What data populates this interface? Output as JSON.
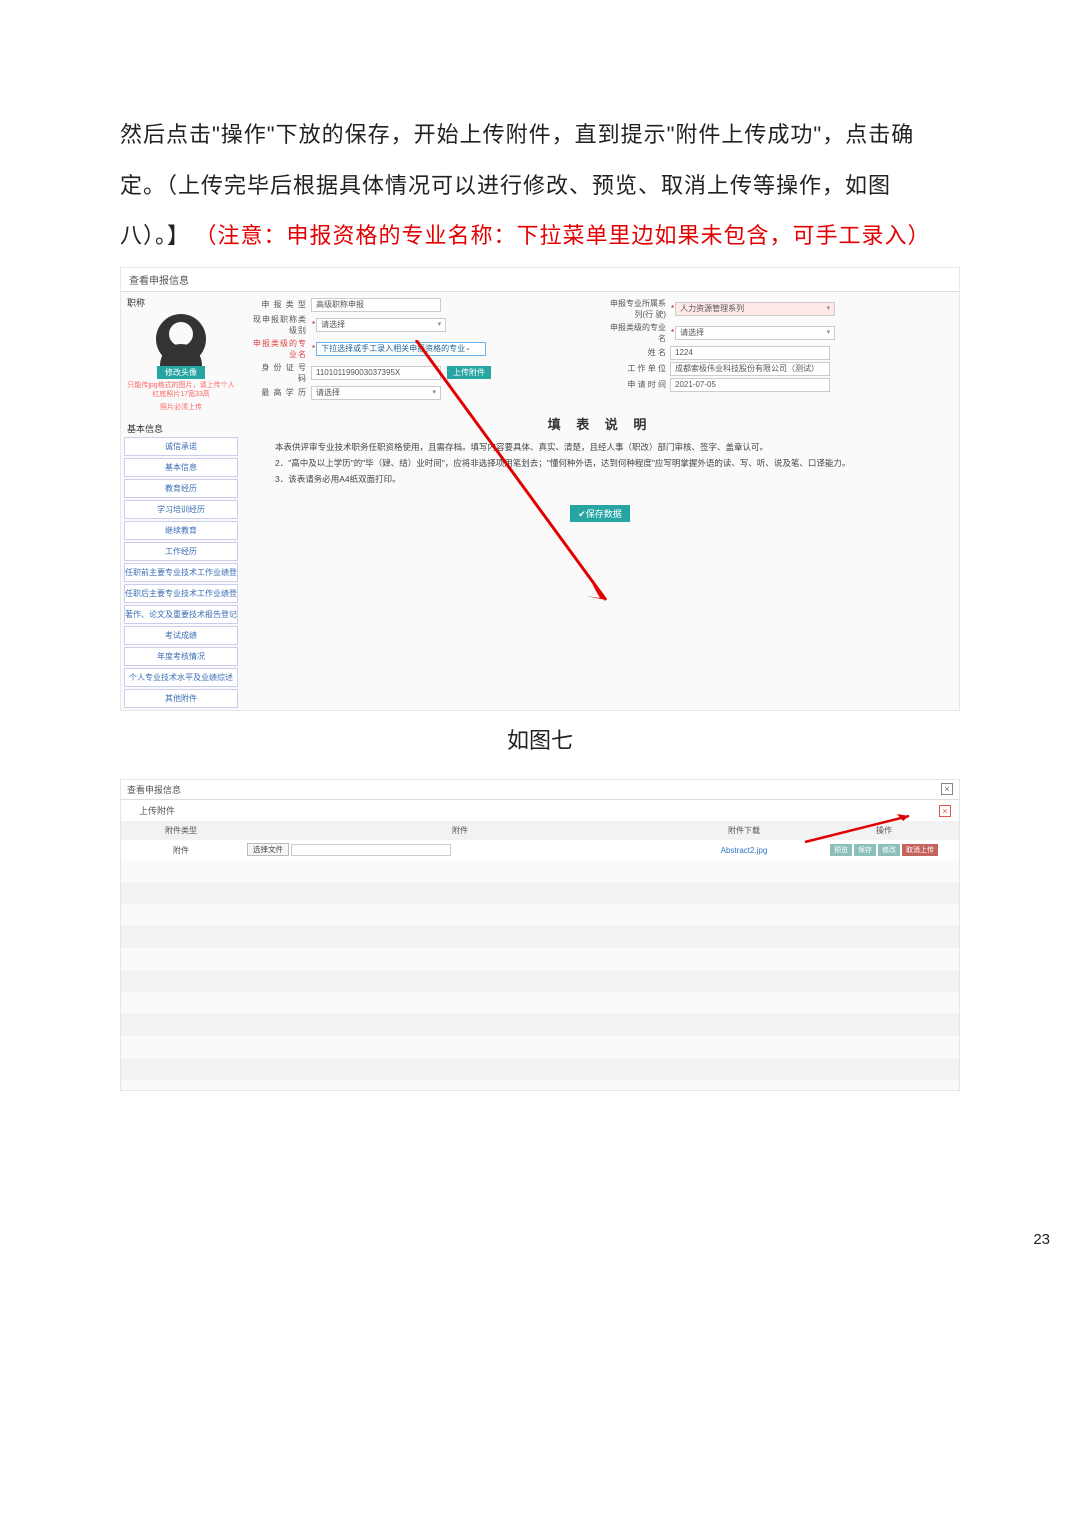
{
  "paragraph": {
    "black": "然后点击\"操作\"下放的保存，开始上传附件，直到提示\"附件上传成功\"，点击确定。（上传完毕后根据具体情况可以进行修改、预览、取消上传等操作，如图八）。】",
    "red": "（注意：申报资格的专业名称：下拉菜单里边如果未包含，可手工录入）"
  },
  "fig1_caption": "如图七",
  "page_number": "23",
  "s1": {
    "title": "查看申报信息",
    "sidebar": {
      "cat1": "职称",
      "cat2": "基本信息",
      "avatar_btn": "修改头像",
      "avatar_hint1": "只能传jpg格式的图片，请上传个人红底照片17宽33高",
      "avatar_hint2": "照片必须上传",
      "items": [
        "诚信承诺",
        "基本信息",
        "教育经历",
        "学习培训经历",
        "继续教育",
        "工作经历",
        "任职前主要专业技术工作业绩登",
        "任职后主要专业技术工作业绩登",
        "著作、论文及重要技术报告登记",
        "考试成绩",
        "年度考核情况",
        "个人专业技术水平及业绩综述",
        "其他附件"
      ]
    },
    "form": {
      "l_type": "申 报 类 型",
      "v_type": "高级职称申报",
      "l_curr": "现申报职称类级别",
      "v_curr": "请选择",
      "l_spec": "申报类级的专业名",
      "v_spec": "下拉选择或手工录入相关申报资格的专业",
      "l_id": "身 份 证 号 码",
      "v_id": "110101199003037395X",
      "upload_btn": "上传附件",
      "l_top": "最 高 学 历",
      "v_top": "请选择",
      "l_series": "申报专业所属系列(行   驶)",
      "v_series": "人力资源管理系列",
      "l_slevel": "申报类级的专业名",
      "v_slevel": "请选择",
      "l_name": "姓      名",
      "v_name": "1224",
      "l_unit": "工 作 单 位",
      "v_unit": "成都索极伟业科技股份有限公司（测试）",
      "l_date": "申 请 时 间",
      "v_date": "2021-07-05"
    },
    "fill": {
      "title": "填 表 说 明",
      "p1": "本表供评审专业技术职务任职资格使用，且需存档。填写内容要具体、真实、清楚，且经人事（职改）部门审核、签字、盖章认可。",
      "p2": "2．\"高中及以上学历\"的\"毕（肄、结）业时间\"，应将非选择项用笔划去；\"懂何种外语，达到何种程度\"应写明掌握外语的读、写、听、说及笔、口译能力。",
      "p3": "3．该表请务必用A4纸双面打印。",
      "save": "✔保存数据"
    }
  },
  "s2": {
    "title": "查看申报信息",
    "sub": "上传附件",
    "th": [
      "附件类型",
      "附件",
      "附件下载",
      "操作"
    ],
    "td_type": "附件",
    "choose": "选择文件",
    "download": "Abstract2.jpg",
    "ops": [
      "预览",
      "保存",
      "修改",
      "取消上传"
    ]
  }
}
